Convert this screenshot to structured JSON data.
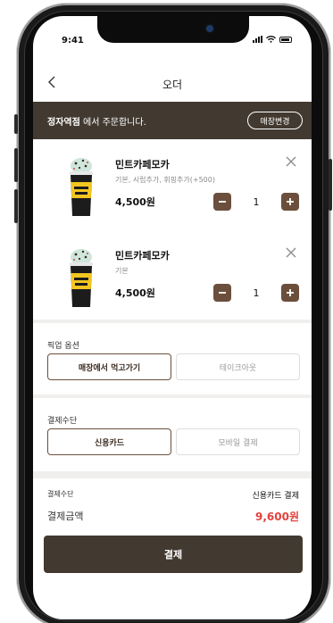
{
  "status": {
    "time": "9:41"
  },
  "nav": {
    "title": "오더"
  },
  "store": {
    "name": "정자역점",
    "suffix": "에서 주문합니다.",
    "change_label": "매장변경"
  },
  "items": [
    {
      "name": "민트카페모카",
      "options": "기본, 시럽추가, 휘핑추가(+500)",
      "price": "4,500원",
      "qty": "1"
    },
    {
      "name": "민트카페모카",
      "options": "기본",
      "price": "4,500원",
      "qty": "1"
    }
  ],
  "pickup": {
    "label": "픽업 옵션",
    "options": [
      "매장에서 먹고가기",
      "테이크아웃"
    ],
    "selected": "매장에서 먹고가기"
  },
  "payment_method": {
    "label": "결제수단",
    "options": [
      "신용카드",
      "모바일 결제"
    ],
    "selected": "신용카드"
  },
  "summary": {
    "method_label": "결제수단",
    "method_value": "신용카드 결제",
    "amount_label": "결제금액",
    "amount_value": "9,600원"
  },
  "pay_button": "결제",
  "colors": {
    "brand_dark": "#423a31",
    "accent_brown": "#6b4f3c",
    "total_red": "#e2413c"
  },
  "icons": {
    "back": "chevron-left-icon",
    "close": "close-icon",
    "minus": "minus-icon",
    "plus": "plus-icon"
  }
}
